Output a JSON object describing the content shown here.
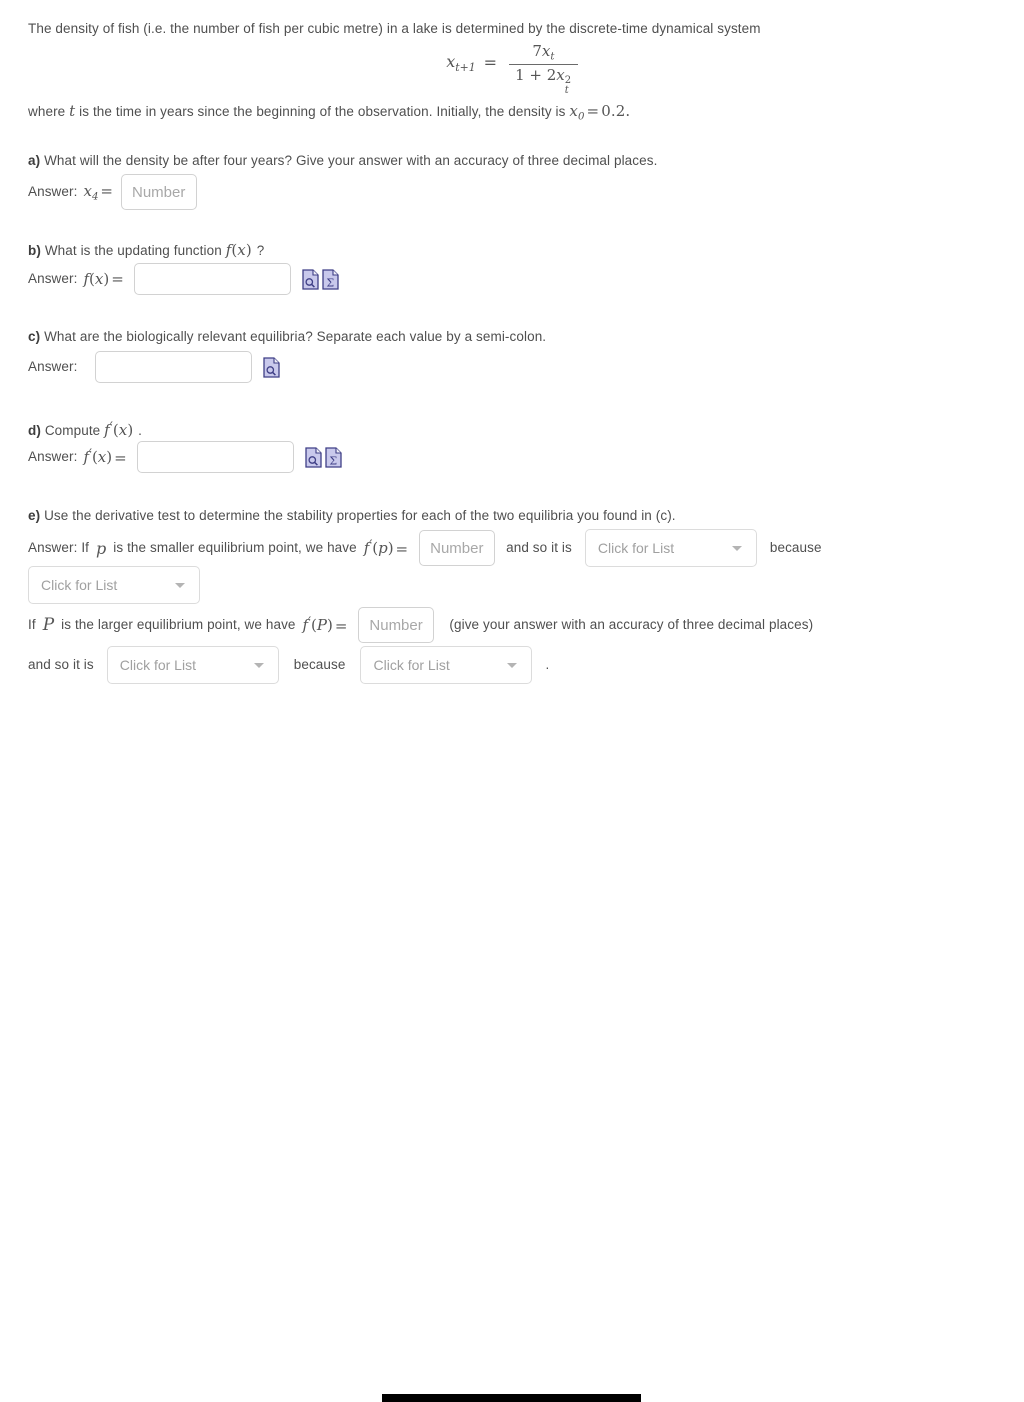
{
  "problem": {
    "intro_text": "The density of fish (i.e. the number of fish per cubic metre) in a lake is determined by the discrete-time dynamical system",
    "equation": {
      "lhs_var": "x",
      "lhs_sub": "t+1",
      "relation": "=",
      "numerator": "7x",
      "numerator_sub": "t",
      "denominator": "1 + 2x",
      "denominator_sub": "t",
      "denominator_sup": "2",
      "plain": "x_(t+1) = 7x_t / (1 + 2x_t^2)"
    },
    "where_prefix": "where",
    "where_var": "t",
    "where_text": "is the time in years since the beginning of the observation. Initially, the density is",
    "initial_var": "x",
    "initial_sub": "0",
    "initial_eq": "=",
    "initial_value": "0.2",
    "initial_period": "."
  },
  "parts": {
    "a": {
      "label": "a)",
      "question": "What will the density be after four years? Give your answer with an accuracy of three decimal places.",
      "answer_prefix": "Answer:",
      "answer_var": "x",
      "answer_sub": "4",
      "answer_eq": "=",
      "input_placeholder": "Number"
    },
    "b": {
      "label": "b)",
      "question_pre": "What is the updating function",
      "question_math": "f(x)",
      "question_post": "?",
      "answer_prefix": "Answer:",
      "answer_math": "f(x)",
      "answer_eq": "=",
      "input_value": "",
      "input_placeholder": "",
      "icons": [
        "preview-icon",
        "math-palette-icon"
      ]
    },
    "c": {
      "label": "c)",
      "question": "What are the biologically relevant equilibria? Separate each value by a semi-colon.",
      "answer_prefix": "Answer:",
      "input_value": "",
      "input_placeholder": "",
      "icons": [
        "preview-icon"
      ]
    },
    "d": {
      "label": "d)",
      "question_pre": "Compute",
      "question_math": "f'(x)",
      "question_post": ".",
      "answer_prefix": "Answer:",
      "answer_math": "f'(x)",
      "answer_eq": "=",
      "input_value": "",
      "input_placeholder": "",
      "icons": [
        "preview-icon",
        "math-palette-icon"
      ]
    },
    "e": {
      "label": "e)",
      "question": "Use the derivative test to determine the stability properties for each of the two equilibria you found in (c).",
      "line1": {
        "answer_prefix": "Answer: If",
        "var_small": "p",
        "text_mid": "is the smaller equilibrium point, we have",
        "deriv_math": "f'(p)",
        "eq": "=",
        "number_placeholder": "Number",
        "and_so_text": "and so it is",
        "select_stability": "Click for List",
        "because_text": "because"
      },
      "line2": {
        "select_reason": "Click for List"
      },
      "line3": {
        "prefix": "If",
        "var_big": "P",
        "text_mid": "is the larger equilibrium point, we have",
        "deriv_math": "f'(P)",
        "eq": "=",
        "number_placeholder": "Number",
        "hint": "(give your answer with an accuracy of three decimal places)"
      },
      "line4": {
        "and_so_text": "and so it is",
        "select_stability": "Click for List",
        "because_text": "because",
        "select_reason": "Click for List",
        "period": "."
      }
    }
  },
  "scrollbar": {
    "orientation": "horizontal",
    "thumb_label": "horizontal-scroll-thumb"
  },
  "colors": {
    "text": "#4f4f4f",
    "math": "#555555",
    "placeholder": "#a0a0a0",
    "border": "#d6d6d6",
    "icon_fill": "#c8c8e8",
    "icon_stroke": "#4a4a8c",
    "scrollbar": "#000000"
  }
}
